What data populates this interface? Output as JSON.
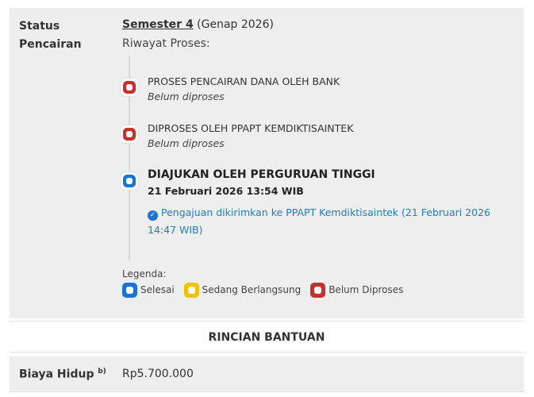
{
  "status": {
    "label_line1": "Status",
    "label_line2": "Pencairan"
  },
  "semester": {
    "link": "Semester 4",
    "suffix": "(Genap 2026)"
  },
  "riwayat_label": "Riwayat Proses:",
  "timeline": [
    {
      "title": "PROSES PENCAIRAN DANA OLEH BANK",
      "subtitle": "Belum diproses",
      "state": "belum-diproses",
      "color": "#c9302c"
    },
    {
      "title": "DIPROSES OLEH PPAPT KEMDIKTISAINTEK",
      "subtitle": "Belum diproses",
      "state": "belum-diproses",
      "color": "#c9302c"
    },
    {
      "title": "DIAJUKAN OLEH PERGURUAN TINGGI",
      "subtitle": "21 Februari 2026 13:54 WIB",
      "state": "selesai",
      "color": "#1a73d9",
      "note": "Pengajuan dikirimkan ke PPAPT Kemdiktisaintek (21 Februari 2026 14:47 WIB)",
      "note_icon": "check-circle-icon"
    }
  ],
  "legend": {
    "title": "Legenda:",
    "items": [
      {
        "label": "Selesai",
        "color": "#1a73d9"
      },
      {
        "label": "Sedang Berlangsung",
        "color": "#f2c200"
      },
      {
        "label": "Belum Diproses",
        "color": "#c9302c"
      }
    ]
  },
  "rincian": {
    "title": "RINCIAN BANTUAN"
  },
  "biaya_hidup": {
    "label": "Biaya Hidup",
    "footnote": "b)",
    "value": "Rp5.700.000"
  }
}
